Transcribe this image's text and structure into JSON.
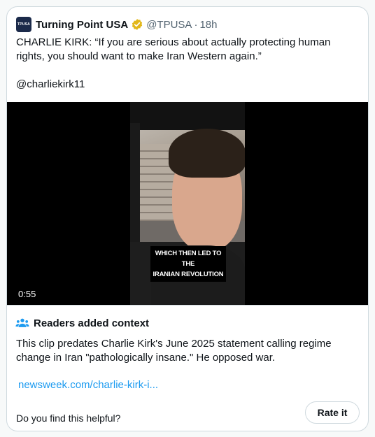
{
  "tweet": {
    "display_name": "Turning Point USA",
    "handle": "@TPUSA",
    "separator": "·",
    "time": "18h",
    "avatar_text": "TPUSA",
    "text_line1": "CHARLIE KIRK: “If you are serious about actually protecting human rights, you should want to make Iran Western again.”",
    "text_line2": "@charliekirk11",
    "verified_icon": "verified-badge-icon"
  },
  "video": {
    "caption_line1": "WHICH THEN LED TO THE",
    "caption_line2": "IRANIAN REVOLUTION",
    "duration": "0:55"
  },
  "context": {
    "icon": "readers-people-icon",
    "title": "Readers added context",
    "body": "This clip predates Charlie Kirk's June 2025 statement calling regime change in Iran \"pathologically insane.\" He opposed war.",
    "link": "newsweek.com/charlie-kirk-i...",
    "question": "Do you find this helpful?",
    "rate_label": "Rate it"
  },
  "colors": {
    "accent": "#1d9bf0",
    "verified": "#e2b719",
    "text": "#0f1419",
    "muted": "#536471",
    "border": "#cfd9de"
  }
}
